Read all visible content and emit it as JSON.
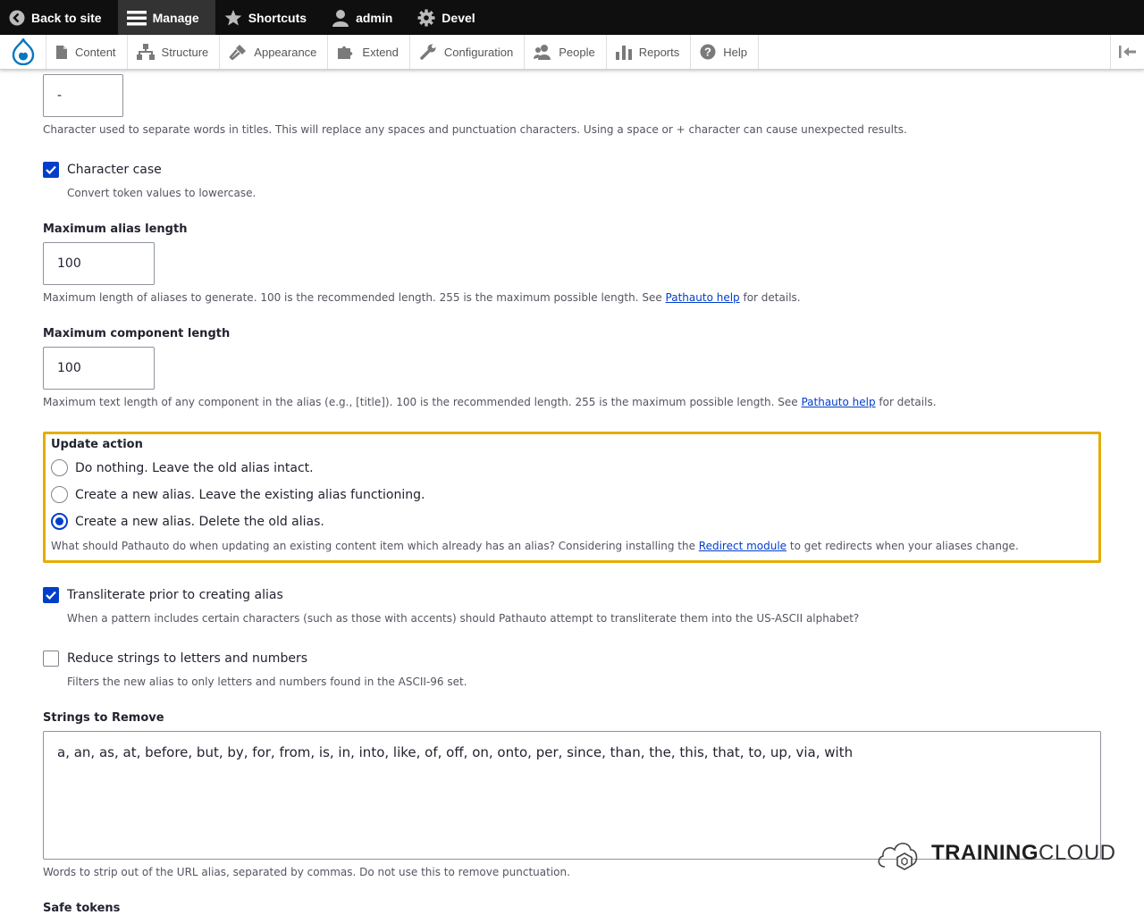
{
  "toolbar": {
    "back_to_site": "Back to site",
    "manage": "Manage",
    "shortcuts": "Shortcuts",
    "user": "admin",
    "devel": "Devel"
  },
  "tray": {
    "items": [
      "Content",
      "Structure",
      "Appearance",
      "Extend",
      "Configuration",
      "People",
      "Reports",
      "Help"
    ]
  },
  "form": {
    "separator": {
      "value": "-",
      "description": "Character used to separate words in titles. This will replace any spaces and punctuation characters. Using a space or + character can cause unexpected results."
    },
    "character_case": {
      "label": "Character case",
      "checked": true,
      "description": "Convert token values to lowercase."
    },
    "max_alias_length": {
      "label": "Maximum alias length",
      "value": "100",
      "description_pre": "Maximum length of aliases to generate. 100 is the recommended length. 255 is the maximum possible length. See ",
      "link": "Pathauto help",
      "description_post": " for details."
    },
    "max_component_length": {
      "label": "Maximum component length",
      "value": "100",
      "description_pre": "Maximum text length of any component in the alias (e.g., [title]). 100 is the recommended length. 255 is the maximum possible length. See ",
      "link": "Pathauto help",
      "description_post": " for details."
    },
    "update_action": {
      "legend": "Update action",
      "options": [
        {
          "label": "Do nothing. Leave the old alias intact.",
          "selected": false
        },
        {
          "label": "Create a new alias. Leave the existing alias functioning.",
          "selected": false
        },
        {
          "label": "Create a new alias. Delete the old alias.",
          "selected": true
        }
      ],
      "description_pre": "What should Pathauto do when updating an existing content item which already has an alias? Considering installing the ",
      "link": "Redirect module",
      "description_post": " to get redirects when your aliases change."
    },
    "transliterate": {
      "label": "Transliterate prior to creating alias",
      "checked": true,
      "description": "When a pattern includes certain characters (such as those with accents) should Pathauto attempt to transliterate them into the US-ASCII alphabet?"
    },
    "reduce_ascii": {
      "label": "Reduce strings to letters and numbers",
      "checked": false,
      "description": "Filters the new alias to only letters and numbers found in the ASCII-96 set."
    },
    "ignore_words": {
      "label": "Strings to Remove",
      "value": "a, an, as, at, before, but, by, for, from, is, in, into, like, of, off, on, onto, per, since, than, the, this, that, to, up, via, with",
      "description": "Words to strip out of the URL alias, separated by commas. Do not use this to remove punctuation."
    },
    "safe_tokens": {
      "label": "Safe tokens"
    }
  },
  "watermark": {
    "part1": "TRAINING",
    "part2": "CLOUD"
  }
}
